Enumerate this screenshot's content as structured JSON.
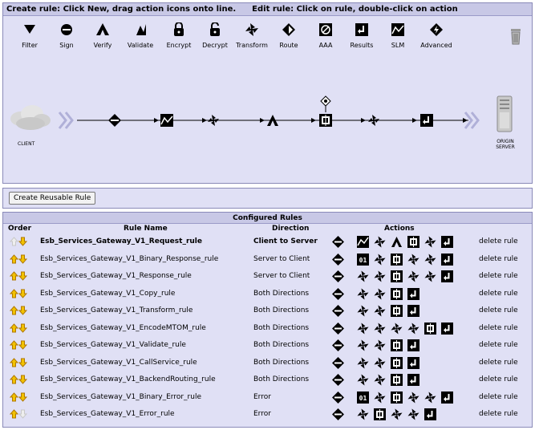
{
  "editor": {
    "header_create": "Create rule: Click New, drag action icons onto line.",
    "header_edit": "Edit rule: Click on rule, double-click on action",
    "tools": [
      {
        "label": "Filter",
        "icon": "filter-icon"
      },
      {
        "label": "Sign",
        "icon": "sign-icon"
      },
      {
        "label": "Verify",
        "icon": "verify-icon"
      },
      {
        "label": "Validate",
        "icon": "validate-icon"
      },
      {
        "label": "Encrypt",
        "icon": "encrypt-icon"
      },
      {
        "label": "Decrypt",
        "icon": "decrypt-icon"
      },
      {
        "label": "Transform",
        "icon": "transform-icon"
      },
      {
        "label": "Route",
        "icon": "route-icon"
      },
      {
        "label": "AAA",
        "icon": "aaa-icon"
      },
      {
        "label": "Results",
        "icon": "results-icon"
      },
      {
        "label": "SLM",
        "icon": "slm-icon"
      },
      {
        "label": "Advanced",
        "icon": "advanced-icon"
      }
    ],
    "client_label": "CLIENT",
    "server_label_1": "ORIGIN",
    "server_label_2": "SERVER"
  },
  "reusable_button": "Create Reusable Rule",
  "rules": {
    "title": "Configured Rules",
    "headers": {
      "order": "Order",
      "name": "Rule Name",
      "direction": "Direction",
      "actions": "Actions"
    },
    "delete_label": "delete rule",
    "rows": [
      {
        "name": "Esb_Services_Gateway_V1_Request_rule",
        "direction": "Client to Server",
        "selected": true,
        "up": false,
        "down": true,
        "actions": [
          "match",
          "slm",
          "transform",
          "verify",
          "conditional",
          "transform",
          "results"
        ]
      },
      {
        "name": "Esb_Services_Gateway_V1_Binary_Response_rule",
        "direction": "Server to Client",
        "selected": false,
        "up": true,
        "down": true,
        "actions": [
          "match",
          "binary",
          "transform",
          "conditional",
          "transform",
          "transform",
          "results"
        ]
      },
      {
        "name": "Esb_Services_Gateway_V1_Response_rule",
        "direction": "Server to Client",
        "selected": false,
        "up": true,
        "down": true,
        "actions": [
          "match",
          "transform",
          "transform",
          "conditional",
          "transform",
          "transform",
          "results"
        ]
      },
      {
        "name": "Esb_Services_Gateway_V1_Copy_rule",
        "direction": "Both Directions",
        "selected": false,
        "up": true,
        "down": true,
        "actions": [
          "match",
          "transform",
          "transform",
          "conditional",
          "results"
        ]
      },
      {
        "name": "Esb_Services_Gateway_V1_Transform_rule",
        "direction": "Both Directions",
        "selected": false,
        "up": true,
        "down": true,
        "actions": [
          "match",
          "transform",
          "transform",
          "conditional",
          "results"
        ]
      },
      {
        "name": "Esb_Services_Gateway_V1_EncodeMTOM_rule",
        "direction": "Both Directions",
        "selected": false,
        "up": true,
        "down": true,
        "actions": [
          "match",
          "transform",
          "transform",
          "transform",
          "transform",
          "conditional",
          "results"
        ]
      },
      {
        "name": "Esb_Services_Gateway_V1_Validate_rule",
        "direction": "Both Directions",
        "selected": false,
        "up": true,
        "down": true,
        "actions": [
          "match",
          "transform",
          "transform",
          "conditional",
          "results"
        ]
      },
      {
        "name": "Esb_Services_Gateway_V1_CallService_rule",
        "direction": "Both Directions",
        "selected": false,
        "up": true,
        "down": true,
        "actions": [
          "match",
          "transform",
          "transform",
          "conditional",
          "results"
        ]
      },
      {
        "name": "Esb_Services_Gateway_V1_BackendRouting_rule",
        "direction": "Both Directions",
        "selected": false,
        "up": true,
        "down": true,
        "actions": [
          "match",
          "transform",
          "transform",
          "conditional",
          "results"
        ]
      },
      {
        "name": "Esb_Services_Gateway_V1_Binary_Error_rule",
        "direction": "Error",
        "selected": false,
        "up": true,
        "down": true,
        "actions": [
          "match",
          "binary",
          "transform",
          "conditional",
          "transform",
          "transform",
          "results"
        ]
      },
      {
        "name": "Esb_Services_Gateway_V1_Error_rule",
        "direction": "Error",
        "selected": false,
        "up": true,
        "down": false,
        "actions": [
          "match",
          "transform",
          "conditional",
          "transform",
          "transform",
          "results"
        ]
      }
    ]
  }
}
